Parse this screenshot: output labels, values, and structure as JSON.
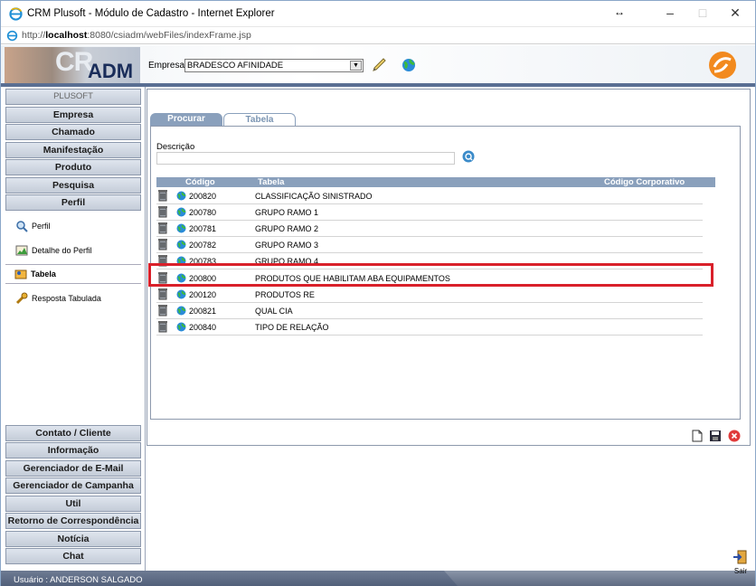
{
  "window": {
    "title": "CRM Plusoft - Módulo de Cadastro - Internet Explorer",
    "url_prefix": "http://",
    "url_host": "localhost",
    "url_rest": ":8080/csiadm/webFiles/indexFrame.jsp"
  },
  "header": {
    "logo_cr": "CR",
    "logo_adm": "ADM",
    "empresa_label": "Empresa:",
    "empresa_value": "BRADESCO AFINIDADE"
  },
  "sidebar": {
    "top_items": [
      "PLUSOFT",
      "Empresa",
      "Chamado",
      "Manifestação",
      "Produto",
      "Pesquisa",
      "Perfil"
    ],
    "sub_items": [
      "Perfil",
      "Detalhe do Perfil",
      "Tabela",
      "Resposta Tabulada"
    ],
    "active_sub": "Tabela",
    "bottom_items": [
      "Contato / Cliente",
      "Informação",
      "Gerenciador de E-Mail",
      "Gerenciador de Campanha",
      "Util",
      "Retorno de Correspondência",
      "Notícia",
      "Chat"
    ]
  },
  "tabs": {
    "procurar": "Procurar",
    "tabela": "Tabela"
  },
  "search": {
    "label": "Descrição",
    "value": ""
  },
  "grid": {
    "headers": {
      "codigo": "Código",
      "tabela": "Tabela",
      "codigo_corporativo": "Código Corporativo"
    },
    "rows": [
      {
        "code": "200820",
        "name": "CLASSIFICAÇÃO SINISTRADO"
      },
      {
        "code": "200780",
        "name": "GRUPO RAMO 1"
      },
      {
        "code": "200781",
        "name": "GRUPO RAMO 2"
      },
      {
        "code": "200782",
        "name": "GRUPO RAMO 3"
      },
      {
        "code": "200783",
        "name": "GRUPO RAMO 4"
      },
      {
        "code": "200800",
        "name": "PRODUTOS QUE HABILITAM ABA EQUIPAMENTOS"
      },
      {
        "code": "200120",
        "name": "PRODUTOS RE"
      },
      {
        "code": "200821",
        "name": "QUAL CIA"
      },
      {
        "code": "200840",
        "name": "TIPO DE RELAÇÃO"
      }
    ]
  },
  "status": {
    "user": "Usuário : ANDERSON SALGADO"
  },
  "sair_label": "Sair",
  "colors": {
    "accent": "#8aa0bc",
    "highlight": "#d9202a",
    "header_bar": "#5a6f93"
  },
  "icons": {
    "trash": "trash-icon",
    "globe": "globe-icon",
    "search": "search-icon",
    "new": "new-doc-icon",
    "save": "save-icon",
    "cancel": "cancel-icon",
    "exit": "exit-icon"
  }
}
